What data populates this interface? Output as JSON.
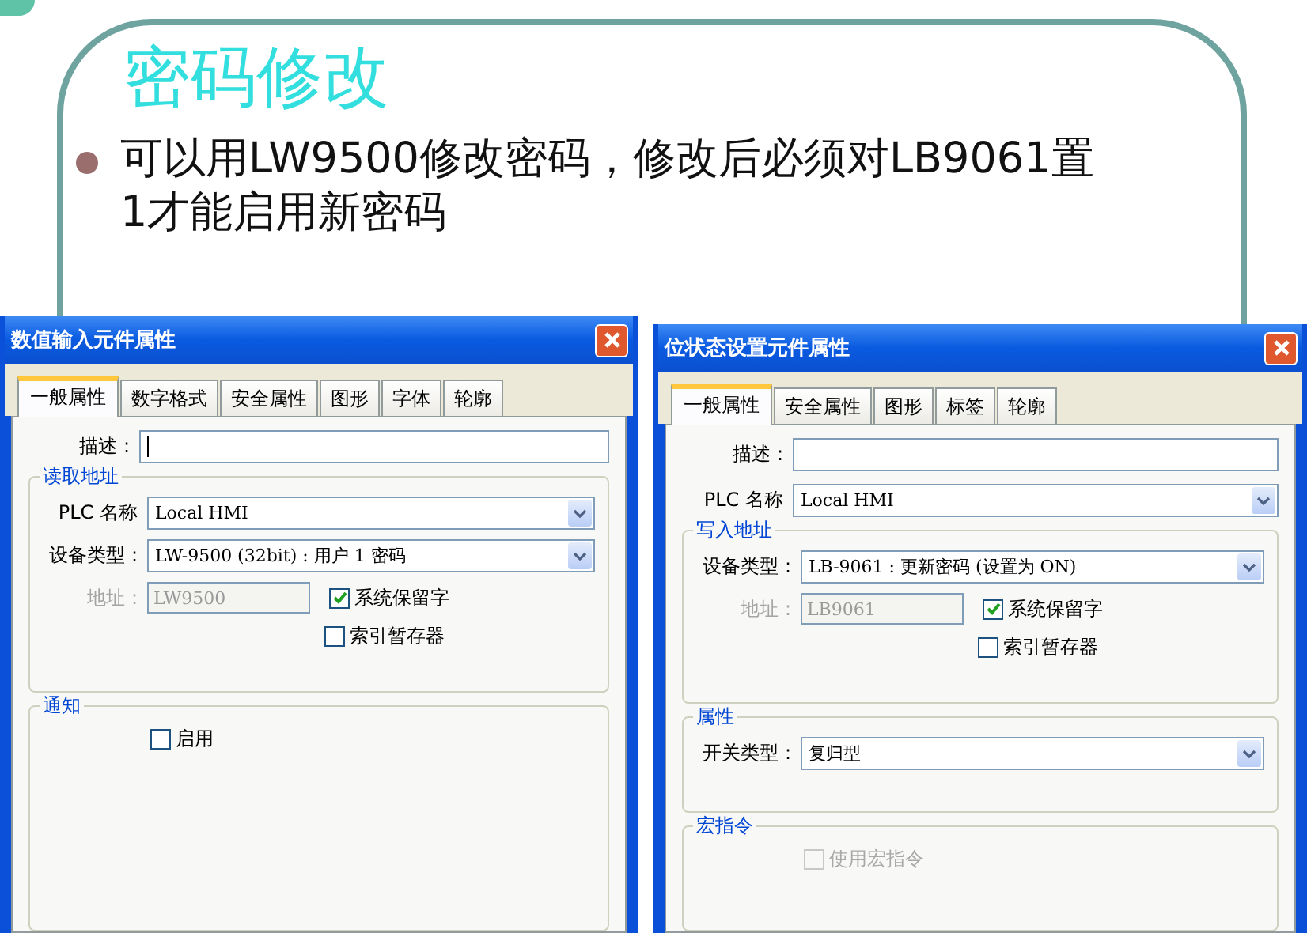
{
  "slide": {
    "title": "密码修改",
    "bullets": [
      "可以用LW9500修改密码，修改后必须对LB9061置1才能启用新密码"
    ]
  },
  "dialogs": [
    {
      "title": "数值输入元件属性",
      "tabs": [
        {
          "label": "一般属性",
          "selected": true
        },
        {
          "label": "数字格式",
          "selected": false
        },
        {
          "label": "安全属性",
          "selected": false
        },
        {
          "label": "图形",
          "selected": false
        },
        {
          "label": "字体",
          "selected": false
        },
        {
          "label": "轮廓",
          "selected": false
        }
      ],
      "items": [
        {
          "kind": "text",
          "label": "描述 :",
          "focused": true
        },
        {
          "kind": "group",
          "label": "读取地址",
          "items": [
            {
              "kind": "select",
              "label": "PLC 名称",
              "value": "Local HMI"
            },
            {
              "kind": "select",
              "label": "设备类型 :",
              "value": "LW-9500 (32bit) : 用户 1 密码"
            },
            {
              "kind": "address",
              "label": "地址 :",
              "value": "LW9500",
              "disabled": true,
              "checkbox": {
                "label": "系统保留字",
                "checked": true
              }
            },
            {
              "kind": "checkbox",
              "label": "索引暂存器",
              "checked": false,
              "disabled": false
            }
          ]
        },
        {
          "kind": "group",
          "label": "通知",
          "items": [
            {
              "kind": "checkbox",
              "label": "启用",
              "checked": false,
              "disabled": false
            }
          ]
        }
      ]
    },
    {
      "title": "位状态设置元件属性",
      "tabs": [
        {
          "label": "一般属性",
          "selected": true
        },
        {
          "label": "安全属性",
          "selected": false
        },
        {
          "label": "图形",
          "selected": false
        },
        {
          "label": "标签",
          "selected": false
        },
        {
          "label": "轮廓",
          "selected": false
        }
      ],
      "items": [
        {
          "kind": "text",
          "label": "描述 :",
          "focused": false
        },
        {
          "kind": "select",
          "label": "PLC 名称",
          "value": "Local HMI"
        },
        {
          "kind": "group",
          "label": "写入地址",
          "items": [
            {
              "kind": "select",
              "label": "设备类型 :",
              "value": "LB-9061 : 更新密码 (设置为 ON)"
            },
            {
              "kind": "address",
              "label": "地址 :",
              "value": "LB9061",
              "disabled": true,
              "checkbox": {
                "label": "系统保留字",
                "checked": true
              }
            },
            {
              "kind": "checkbox",
              "label": "索引暂存器",
              "checked": false,
              "disabled": false
            }
          ]
        },
        {
          "kind": "group",
          "label": "属性",
          "items": [
            {
              "kind": "select",
              "label": "开关类型 :",
              "value": "复归型"
            }
          ]
        },
        {
          "kind": "group",
          "label": "宏指令",
          "items": [
            {
              "kind": "checkbox",
              "label": "使用宏指令",
              "checked": false,
              "disabled": true
            }
          ]
        }
      ]
    }
  ]
}
